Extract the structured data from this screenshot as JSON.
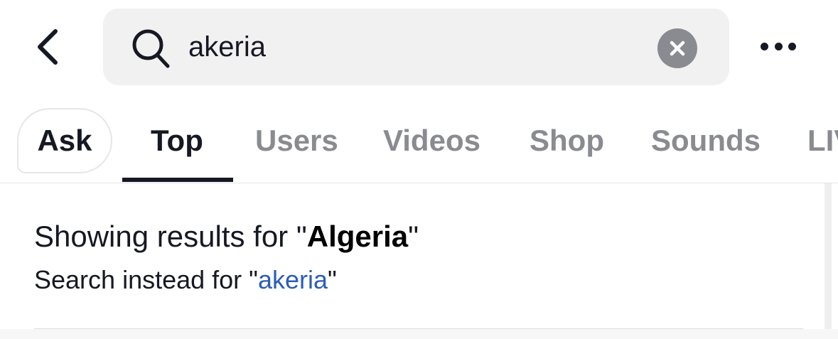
{
  "header": {
    "back_icon": "chevron-left-icon",
    "more_icon": "ellipsis-icon"
  },
  "search": {
    "icon": "search-icon",
    "value": "akeria",
    "clear_icon": "clear-x-icon"
  },
  "tabs": {
    "ask_label": "Ask",
    "items": [
      {
        "label": "Top",
        "active": true
      },
      {
        "label": "Users",
        "active": false
      },
      {
        "label": "Videos",
        "active": false
      },
      {
        "label": "Shop",
        "active": false
      },
      {
        "label": "Sounds",
        "active": false
      },
      {
        "label": "LIVE",
        "active": false
      }
    ]
  },
  "results": {
    "showing_prefix": "Showing results for \"",
    "corrected_query": "Algeria",
    "showing_suffix": "\"",
    "instead_prefix": "Search instead for \"",
    "original_query": "akeria",
    "instead_suffix": "\""
  },
  "colors": {
    "link": "#2b5db9",
    "inactive_tab": "#8a8b91",
    "active_tab": "#161823",
    "search_bg": "#f1f1f2"
  }
}
